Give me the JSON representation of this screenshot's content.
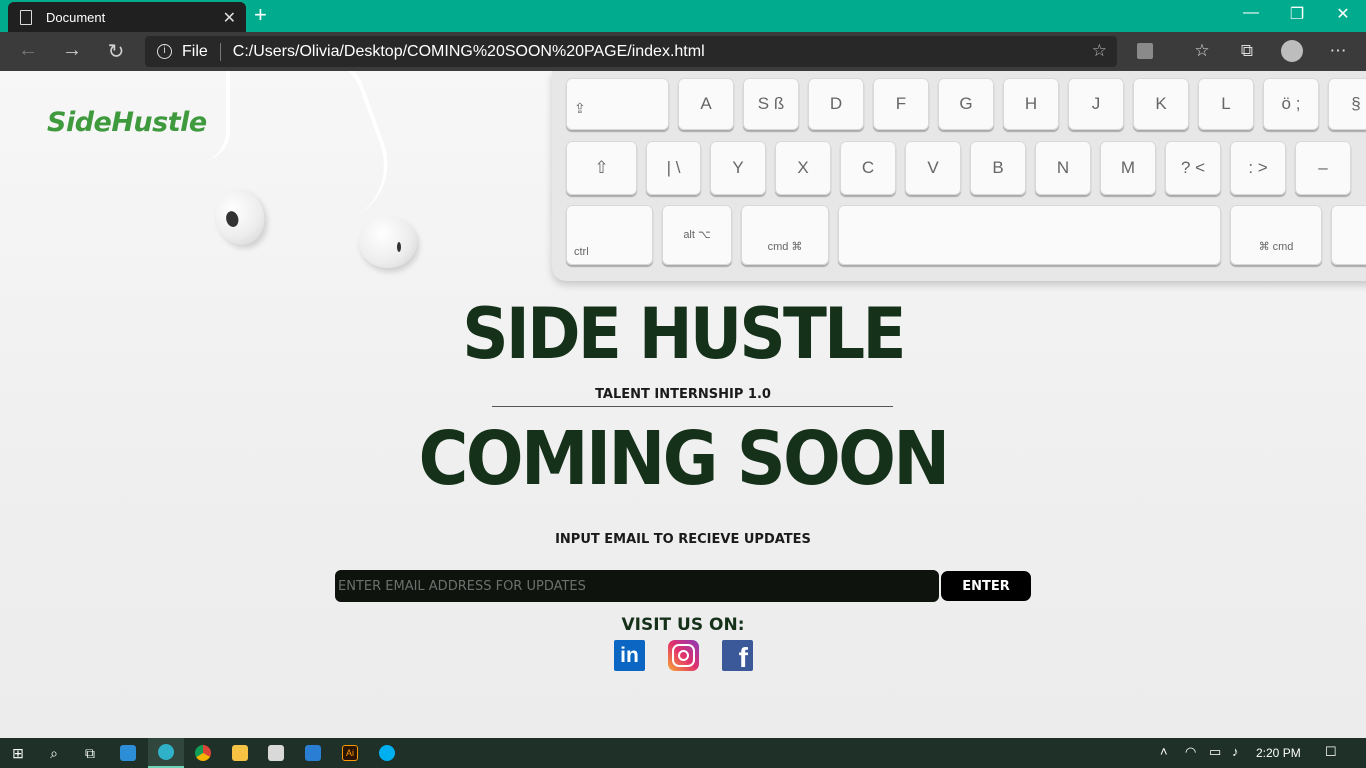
{
  "browser": {
    "tab_title": "Document",
    "url_scheme_label": "File",
    "url": "C:/Users/Olivia/Desktop/COMING%20SOON%20PAGE/index.html"
  },
  "page": {
    "logo_text": "SideHustle",
    "hero_title": "SIDE HUSTLE",
    "subtitle": "TALENT INTERNSHIP 1.0",
    "coming_soon": "COMING SOON",
    "updates_label": "INPUT EMAIL TO RECIEVE UPDATES",
    "email_placeholder": "ENTER EMAIL ADDRESS FOR UPDATES",
    "enter_label": "ENTER",
    "visit_label": "VISIT US ON:",
    "social": [
      {
        "name": "linkedin-icon",
        "label": "in"
      },
      {
        "name": "instagram-icon",
        "label": ""
      },
      {
        "name": "facebook-icon",
        "label": "f"
      }
    ]
  },
  "keyboard": {
    "row1": [
      "",
      "A",
      "S ß",
      "D",
      "F",
      "G",
      "H",
      "J",
      "K",
      "L",
      "ö ;",
      "§"
    ],
    "row2": [
      "⇧",
      "| \\",
      "Y",
      "X",
      "C",
      "V",
      "B",
      "N",
      "M",
      "? <",
      ": >",
      "–"
    ],
    "row3": [
      "ctrl",
      "alt ⌥",
      "cmd ⌘",
      "",
      "⌘ cmd",
      ""
    ]
  },
  "taskbar": {
    "time": "2:20 PM"
  },
  "colors": {
    "titlebar": "#00ab8e",
    "headline": "#16311a",
    "logo": "#3f9a3e"
  }
}
